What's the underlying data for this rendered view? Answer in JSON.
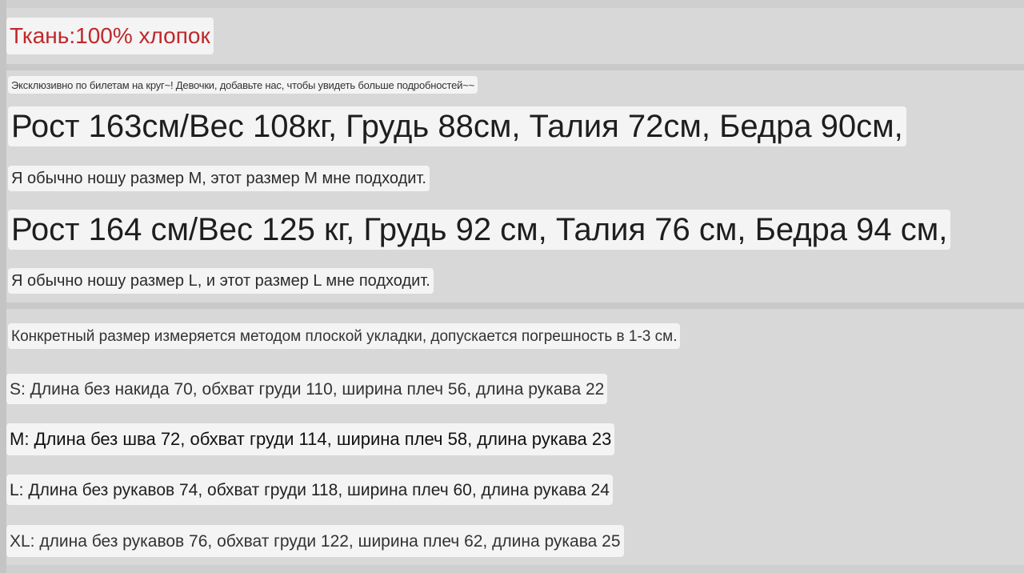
{
  "fabric": "Ткань:100% хлопок",
  "exclusive_note": "Эксклюзивно по билетам на круг~! Девочки, добавьте нас, чтобы увидеть больше подробностей~~",
  "models": [
    {
      "stats": "Рост 163см/Вес 108кг, Грудь 88см, Талия 72см, Бедра 90см,",
      "fit": "Я обычно ношу размер M, этот размер M мне подходит."
    },
    {
      "stats": "Рост 164 см/Вес 125 кг, Грудь 92 см, Талия 76 см, Бедра 94 см,",
      "fit": "Я обычно ношу размер L, и этот размер L мне подходит."
    }
  ],
  "measure_note": "Конкретный размер измеряется методом плоской укладки, допускается погрешность в 1-3 см.",
  "sizes": [
    "S: Длина без накида 70, обхват груди 110, ширина плеч 56, длина рукава 22",
    "M: Длина без шва 72, обхват груди 114, ширина плеч 58, длина рукава 23",
    "L: Длина без рукавов 74, обхват груди 118, ширина плеч 60, длина рукава 24",
    "XL: длина без рукавов 76, обхват груди 122, ширина плеч 62, длина рукава 25"
  ],
  "colors": {
    "fabric_text": "#c0282a",
    "background": "#d8d8d8",
    "chip": "#f4f4f4"
  }
}
